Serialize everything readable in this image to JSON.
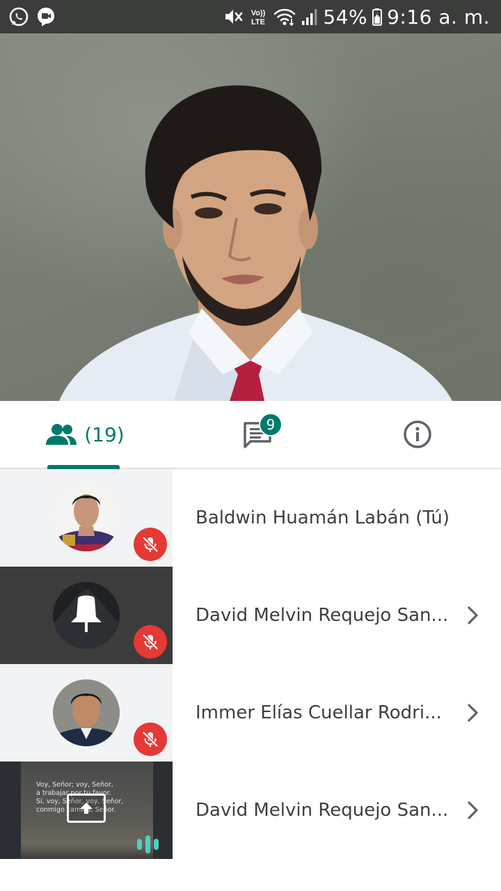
{
  "status_bar": {
    "left_icons": [
      "whatsapp-icon",
      "duo-video-icon"
    ],
    "right_icons": [
      "vibrate-muted-icon",
      "volte-icon",
      "wifi-icon",
      "cell-signal-icon",
      "battery-icon"
    ],
    "volte_label_top": "Vo))",
    "volte_label_bottom": "LTE",
    "battery": "54%",
    "time": "9:16 a. m."
  },
  "video": {
    "description_icon": "participant-video"
  },
  "tabs": {
    "people_count": "(19)",
    "chat_badge": "9",
    "active_tab": "people",
    "accent_color": "#00796b"
  },
  "participants": [
    {
      "name": "Baldwin Huamán Labán (Tú)",
      "muted": true,
      "has_chevron": false,
      "thumb": "avatar-photo"
    },
    {
      "name": "David Melvin Requejo San...",
      "muted": true,
      "has_chevron": true,
      "thumb": "avatar-dark"
    },
    {
      "name": "Immer Elías Cuellar Rodri...",
      "muted": true,
      "has_chevron": true,
      "thumb": "avatar-photo"
    },
    {
      "name": "David Melvin Requejo San...",
      "muted": false,
      "has_chevron": true,
      "thumb": "presentation",
      "speaking": true
    }
  ],
  "presentation": {
    "slide_text": "Voy, Señor; voy, Señor,\na trabajar por tu favor.\nSí, voy, Señor, voy, Señor,\nconmigo camina, Señor."
  },
  "colors": {
    "status_bar_bg": "#3a3d3a",
    "mic_off_red": "#e53935",
    "speaking_teal": "#4dd0c0"
  }
}
